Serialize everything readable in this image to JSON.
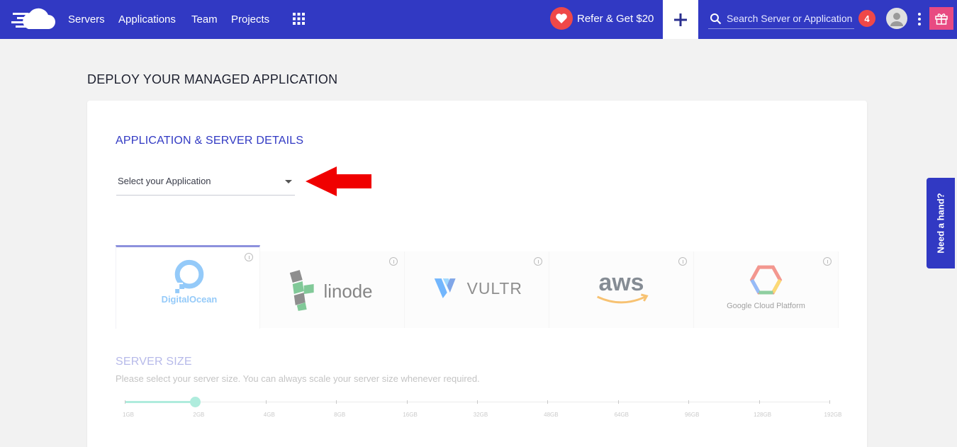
{
  "nav": {
    "links": [
      "Servers",
      "Applications",
      "Team",
      "Projects"
    ],
    "refer_label": "Refer & Get $20",
    "search_placeholder": "Search Server or Application",
    "notification_count": "4",
    "icons": [
      "cloudways-logo",
      "apps-grid-icon",
      "heart-icon",
      "plus-icon",
      "search-icon",
      "user-icon",
      "kebab-menu-icon",
      "gift-icon"
    ]
  },
  "page": {
    "title": "DEPLOY YOUR MANAGED APPLICATION"
  },
  "form": {
    "section_title": "APPLICATION & SERVER DETAILS",
    "app_select_label": "Select your Application"
  },
  "providers": [
    {
      "name": "DigitalOcean",
      "selected": true
    },
    {
      "name": "linode",
      "selected": false
    },
    {
      "name": "VULTR",
      "selected": false
    },
    {
      "name": "aws",
      "selected": false
    },
    {
      "name": "Google Cloud Platform",
      "selected": false
    }
  ],
  "server_size": {
    "title": "SERVER SIZE",
    "description": "Please select your server size. You can always scale your server size whenever required.",
    "options": [
      "1GB",
      "2GB",
      "4GB",
      "8GB",
      "16GB",
      "32GB",
      "48GB",
      "64GB",
      "96GB",
      "128GB",
      "192GB"
    ],
    "selected_index": 1
  },
  "help_tab": "Need a hand?",
  "colors": {
    "brand": "#3139c3",
    "accent_red": "#ef4848",
    "gift": "#e84a82",
    "slider": "#1ec9a0"
  }
}
